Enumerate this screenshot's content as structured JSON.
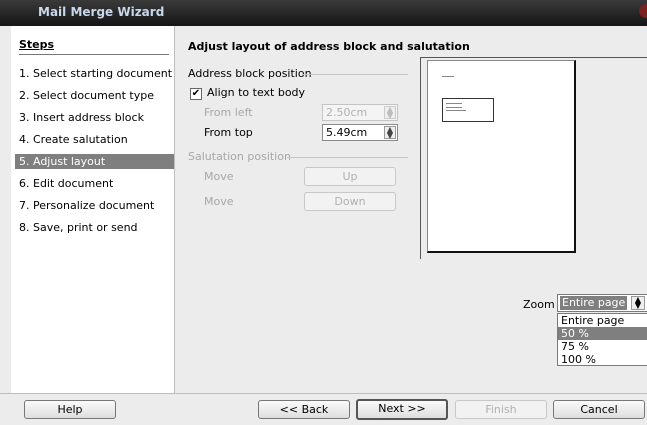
{
  "window": {
    "title": "Mail Merge Wizard"
  },
  "steps": {
    "heading": "Steps",
    "items": [
      "1. Select starting document",
      "2. Select document type",
      "3. Insert address block",
      "4. Create salutation",
      "5. Adjust layout",
      "6. Edit document",
      "7. Personalize document",
      "8. Save, print or send"
    ],
    "active_index": 4
  },
  "main": {
    "heading": "Adjust layout of address block and salutation",
    "address_block": {
      "group_label": "Address block position",
      "align_checkbox": {
        "label": "Align to text body",
        "checked": true
      },
      "from_left": {
        "label": "From left",
        "value": "2.50cm",
        "enabled": false
      },
      "from_top": {
        "label": "From top",
        "value": "5.49cm",
        "enabled": true
      }
    },
    "salutation": {
      "group_label": "Salutation position",
      "move_label_1": "Move",
      "up_button": "Up",
      "move_label_2": "Move",
      "down_button": "Down"
    },
    "zoom": {
      "label": "Zoom",
      "selected": "Entire page",
      "options": [
        "Entire page",
        "50 %",
        "75 %",
        "100 %"
      ],
      "highlighted": "50 %"
    }
  },
  "footer": {
    "help": "Help",
    "back": "<< Back",
    "next": "Next >>",
    "finish": "Finish",
    "cancel": "Cancel"
  },
  "icons": {
    "checkbox_mark": "checkmark-icon",
    "spin_arrows": "spin-arrows-icon"
  }
}
